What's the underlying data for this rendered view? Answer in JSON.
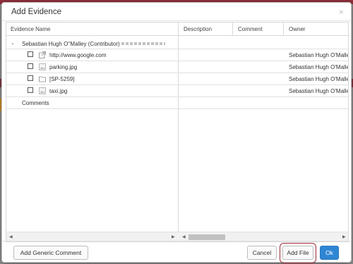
{
  "dialog": {
    "title": "Add Evidence",
    "close_label": "×"
  },
  "grid": {
    "columns": [
      "Evidence Name",
      "Description",
      "Comment",
      "Owner"
    ],
    "group": {
      "label": "Sebastian Hugh O''Malley (Contributor)"
    },
    "rows": [
      {
        "name": "http://www.google.com",
        "icon": "external-link-icon",
        "owner": "Sebastian Hugh O'Malley"
      },
      {
        "name": "parking.jpg",
        "icon": "image-file-icon",
        "owner": "Sebastian Hugh O'Malley"
      },
      {
        "name": "[SP-5259]",
        "icon": "folder-icon",
        "owner": "Sebastian Hugh O'Malley"
      },
      {
        "name": "taxi.jpg",
        "icon": "image-file-icon",
        "owner": "Sebastian Hugh O'Malley"
      }
    ],
    "comments_label": "Comments"
  },
  "footer": {
    "add_generic_comment": "Add Generic Comment",
    "cancel": "Cancel",
    "add_file": "Add File",
    "ok": "Ok"
  },
  "colors": {
    "accent": "#2f86d4",
    "highlight": "#9c2a35"
  }
}
